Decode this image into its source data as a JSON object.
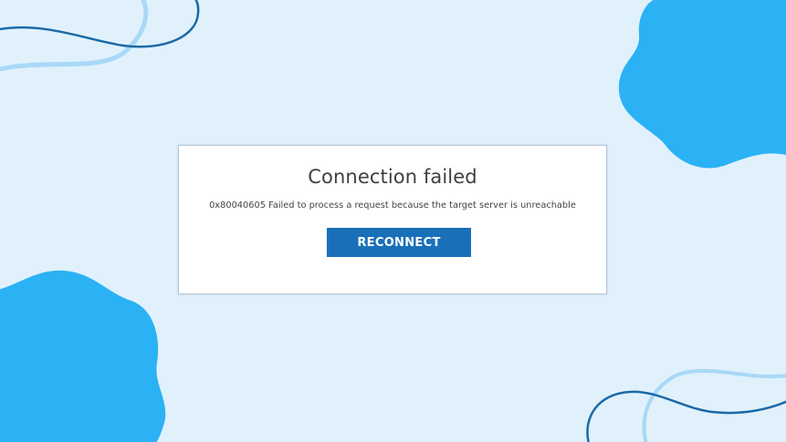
{
  "dialog": {
    "title": "Connection failed",
    "message": "0x80040605 Failed to process a request because the target server is unreachable",
    "button_label": "RECONNECT"
  },
  "colors": {
    "background": "#e1f1fc",
    "blob": "#2ab2f5",
    "line_dark": "#1b6aa8",
    "line_light": "#a7d9f7",
    "button": "#1a70b8"
  }
}
